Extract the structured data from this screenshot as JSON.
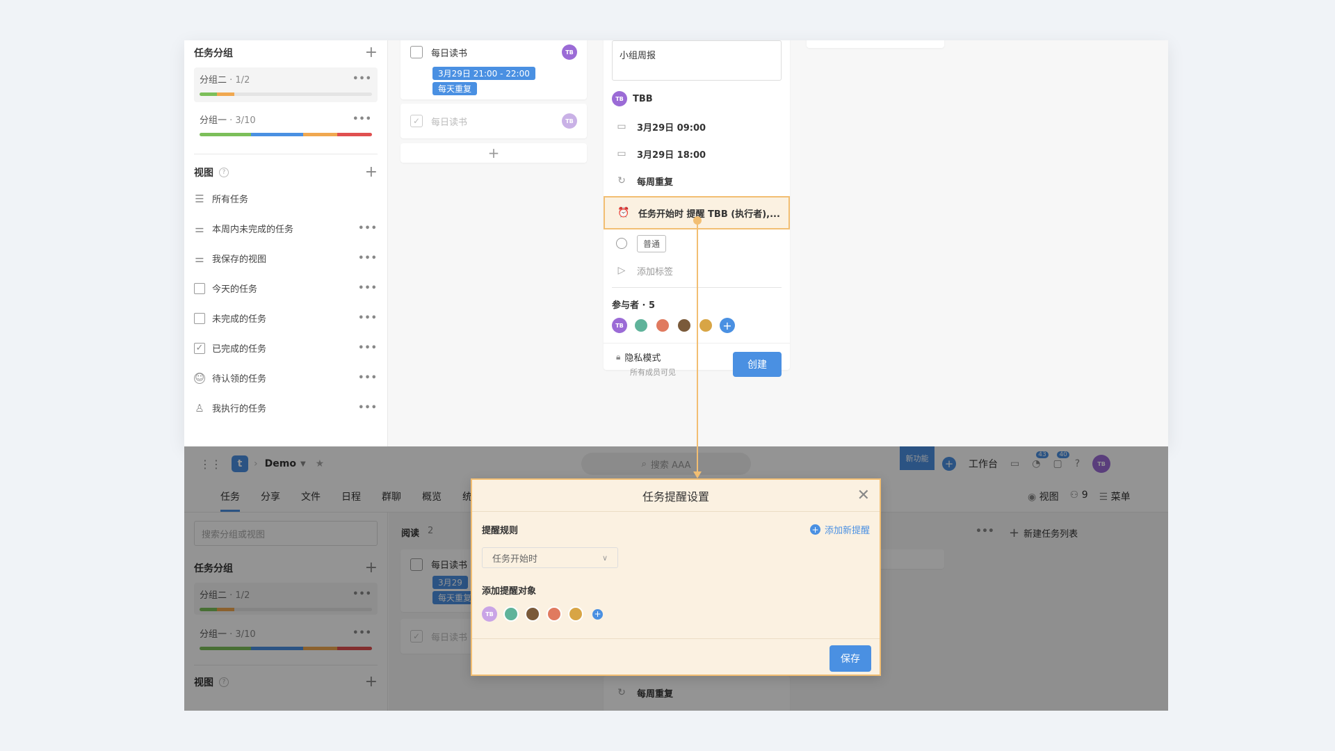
{
  "sidebar": {
    "group_section_title": "任务分组",
    "groups": [
      {
        "name": "分组二",
        "count": " · 1/2",
        "progress": [
          [
            "#7cbf5a",
            0.1
          ],
          [
            "#f0a850",
            0.1
          ]
        ]
      },
      {
        "name": "分组一",
        "count": " · 3/10",
        "progress": [
          [
            "#7cbf5a",
            0.3
          ],
          [
            "#4a90e2",
            0.3
          ],
          [
            "#f0a850",
            0.2
          ],
          [
            "#e05050",
            0.2
          ]
        ]
      }
    ],
    "view_section_title": "视图",
    "views": [
      {
        "label": "所有任务",
        "icon": "list-icon"
      },
      {
        "label": "本周内未完成的任务",
        "icon": "filter-icon"
      },
      {
        "label": "我保存的视图",
        "icon": "filter-icon"
      },
      {
        "label": "今天的任务",
        "icon": "calendar-icon"
      },
      {
        "label": "未完成的任务",
        "icon": "checkbox-icon"
      },
      {
        "label": "已完成的任务",
        "icon": "checked-icon"
      },
      {
        "label": "待认领的任务",
        "icon": "user-circle-icon"
      },
      {
        "label": "我执行的任务",
        "icon": "user-icon"
      }
    ],
    "search_placeholder": "搜索分组或视图"
  },
  "board": {
    "list_name": "阅读",
    "list_count": "2",
    "card1": {
      "title": "每日读书",
      "time_tag": "3月29日 21:00 - 22:00",
      "repeat_tag": "每天重复",
      "assignee": "TB"
    },
    "card2": {
      "title": "每日读书",
      "assignee": "TB"
    },
    "card1_time_short": "3月29",
    "card1_repeat_short": "每天重复",
    "new_list": "新建任务列表"
  },
  "task_form": {
    "name_value": "小组周报",
    "executor": "TBB",
    "start": "3月29日 09:00",
    "end": "3月29日 18:00",
    "repeat": "每周重复",
    "reminder": "任务开始时 提醒 TBB (执行者),...",
    "priority": "普通",
    "tags_placeholder": "添加标签",
    "participants_label": "参与者 · 5",
    "privacy_label": "隐私模式",
    "privacy_sub": "所有成员可见",
    "create_button": "创建"
  },
  "topbar": {
    "project": "Demo",
    "search": "搜索 AAA",
    "new_feature": "新功能",
    "workbench": "工作台",
    "badge_notifications": "43",
    "badge_messages": "40",
    "avatar": "TB",
    "tabs": [
      "任务",
      "分享",
      "文件",
      "日程",
      "群聊",
      "概览",
      "统"
    ],
    "view_label": "视图",
    "members_count": "9",
    "menu_label": "菜单"
  },
  "dialog": {
    "title": "任务提醒设置",
    "rule_label": "提醒规则",
    "add_reminder": "添加新提醒",
    "rule_value": "任务开始时",
    "target_label": "添加提醒对象",
    "save_button": "保存"
  },
  "avatars": {
    "initials": "TB",
    "colors": [
      "#9b6bd6",
      "#5fb39a",
      "#e07a5f",
      "#7a5a3a",
      "#d8a545"
    ]
  },
  "colors": {
    "accent": "#4a90e2",
    "highlight": "#f2be72",
    "purple": "#9b6bd6"
  }
}
